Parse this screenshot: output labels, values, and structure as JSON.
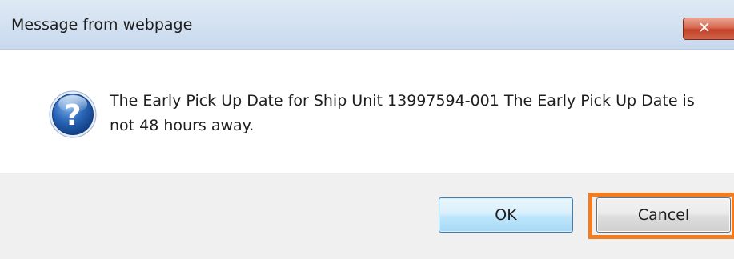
{
  "dialog": {
    "title": "Message from webpage",
    "close_glyph": "✕",
    "message": "The Early Pick Up Date for Ship Unit 13997594-001 The Early Pick Up Date is not 48 hours away.",
    "icon": "question-icon",
    "buttons": {
      "ok_label": "OK",
      "cancel_label": "Cancel"
    },
    "highlighted_button": "cancel",
    "colors": {
      "highlight": "#f47c20",
      "title_bar": "#d4e2f1",
      "close_button": "#c2412a",
      "icon_blue": "#1f5aa8",
      "footer": "#f0f0f0"
    }
  }
}
